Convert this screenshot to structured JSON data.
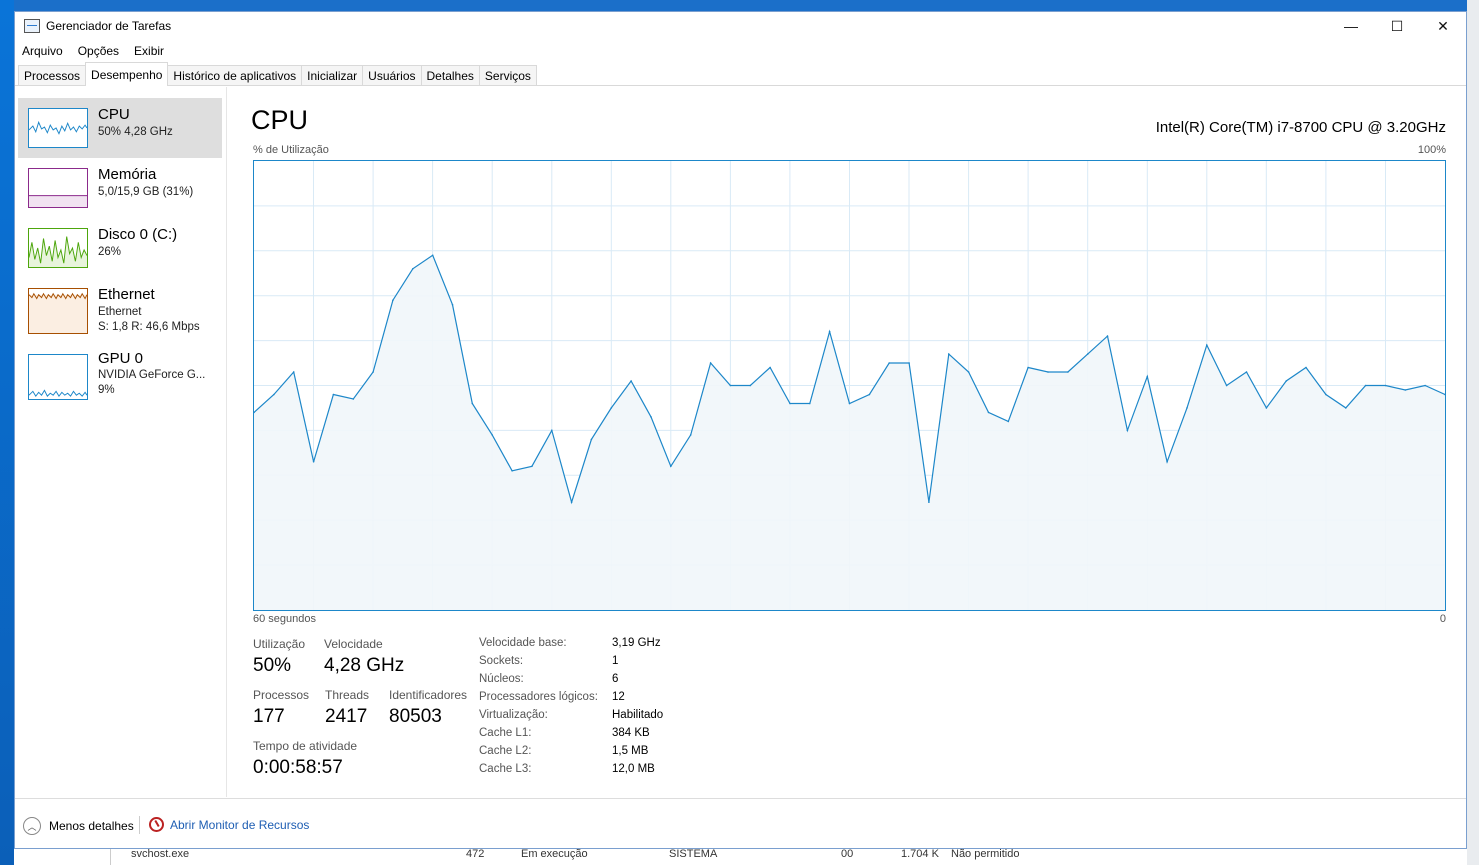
{
  "window": {
    "title": "Gerenciador de Tarefas",
    "minimize": "—",
    "maximize": "☐",
    "close": "✕"
  },
  "menu": [
    "Arquivo",
    "Opções",
    "Exibir"
  ],
  "tabs": [
    "Processos",
    "Desempenho",
    "Histórico de aplicativos",
    "Inicializar",
    "Usuários",
    "Detalhes",
    "Serviços"
  ],
  "active_tab": "Desempenho",
  "sidebar": {
    "items": [
      {
        "name": "CPU",
        "sub1": "50% 4,28 GHz",
        "color": "#1d87c9"
      },
      {
        "name": "Memória",
        "sub1": "5,0/15,9 GB (31%)",
        "color": "#8b2a8b"
      },
      {
        "name": "Disco 0 (C:)",
        "sub1": "26%",
        "color": "#4da60c"
      },
      {
        "name": "Ethernet",
        "sub1": "Ethernet",
        "sub2": "S: 1,8 R: 46,6 Mbps",
        "color": "#a74f01"
      },
      {
        "name": "GPU 0",
        "sub1": "NVIDIA GeForce G...",
        "sub2": "9%",
        "color": "#1d87c9"
      }
    ]
  },
  "main": {
    "heading": "CPU",
    "model": "Intel(R) Core(TM) i7-8700 CPU @ 3.20GHz",
    "chart_label_top": "% de Utilização",
    "chart_max_label": "100%",
    "chart_time_label": "60 segundos",
    "chart_min_label": "0"
  },
  "chart_data": {
    "type": "area",
    "ylim": [
      0,
      100
    ],
    "x": [
      60,
      59,
      58,
      57,
      56,
      55,
      54,
      53,
      52,
      51,
      50,
      49,
      48,
      47,
      46,
      45,
      44,
      43,
      42,
      41,
      40,
      39,
      38,
      37,
      36,
      35,
      34,
      33,
      32,
      31,
      30,
      29,
      28,
      27,
      26,
      25,
      24,
      23,
      22,
      21,
      20,
      19,
      18,
      17,
      16,
      15,
      14,
      13,
      12,
      11,
      10,
      9,
      8,
      7,
      6,
      5,
      4,
      3,
      2,
      1,
      0
    ],
    "values": [
      44,
      48,
      53,
      33,
      48,
      47,
      53,
      69,
      76,
      79,
      68,
      46,
      39,
      31,
      32,
      40,
      24,
      38,
      45,
      51,
      43,
      32,
      39,
      55,
      50,
      50,
      54,
      46,
      46,
      62,
      46,
      48,
      55,
      55,
      24,
      57,
      53,
      44,
      42,
      54,
      53,
      53,
      57,
      61,
      40,
      52,
      33,
      45,
      59,
      50,
      53,
      45,
      51,
      54,
      48,
      45,
      50,
      50,
      49,
      50,
      48
    ],
    "color": "#1d87c9",
    "grid": true
  },
  "stats": {
    "utilizacao_label": "Utilização",
    "utilizacao": "50%",
    "velocidade_label": "Velocidade",
    "velocidade": "4,28 GHz",
    "processos_label": "Processos",
    "processos": "177",
    "threads_label": "Threads",
    "threads": "2417",
    "ident_label": "Identificadores",
    "ident": "80503",
    "uptime_label": "Tempo de atividade",
    "uptime": "0:00:58:57"
  },
  "info": [
    {
      "label": "Velocidade base:",
      "value": "3,19 GHz"
    },
    {
      "label": "Sockets:",
      "value": "1"
    },
    {
      "label": "Núcleos:",
      "value": "6"
    },
    {
      "label": "Processadores lógicos:",
      "value": "12"
    },
    {
      "label": "Virtualização:",
      "value": "Habilitado"
    },
    {
      "label": "Cache L1:",
      "value": "384 KB"
    },
    {
      "label": "Cache L2:",
      "value": "1,5 MB"
    },
    {
      "label": "Cache L3:",
      "value": "12,0 MB"
    }
  ],
  "footer": {
    "less_details": "Menos detalhes",
    "resource_monitor": "Abrir Monitor de Recursos"
  },
  "background_row": {
    "process": "svchost.exe",
    "pid": "472",
    "status": "Em execução",
    "user": "SISTEMA",
    "cpu": "00",
    "mem": "1.704 K",
    "uac": "Não permitido"
  }
}
